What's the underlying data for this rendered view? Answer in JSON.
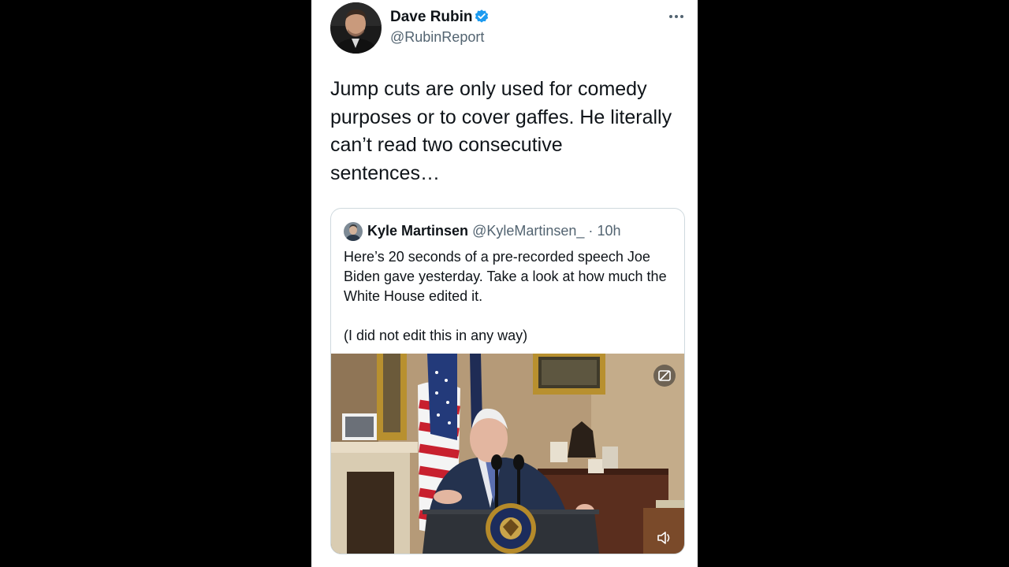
{
  "tweet": {
    "display_name": "Dave Rubin",
    "handle": "@RubinReport",
    "verified": true,
    "text": "Jump cuts are only used for comedy purposes or to cover gaffes. He literally can’t read two consecutive sentences…",
    "icons": {
      "verified": "verified-badge-icon",
      "more": "more-options-icon"
    }
  },
  "quote": {
    "display_name": "Kyle Martinsen",
    "handle": "@KyleMartinsen_",
    "separator": "·",
    "time": "10h",
    "paragraph_1": "Here’s 20 seconds of a pre-recorded speech Joe Biden gave yesterday. Take a look at how much the White House edited it.",
    "paragraph_2": "(I did not edit this in any way)",
    "media": {
      "type": "video",
      "icons": [
        "captions-icon",
        "volume-icon"
      ]
    }
  },
  "colors": {
    "verified": "#1d9bf0",
    "text_primary": "#0f1419",
    "text_secondary": "#536471",
    "border": "#cfd9de"
  }
}
